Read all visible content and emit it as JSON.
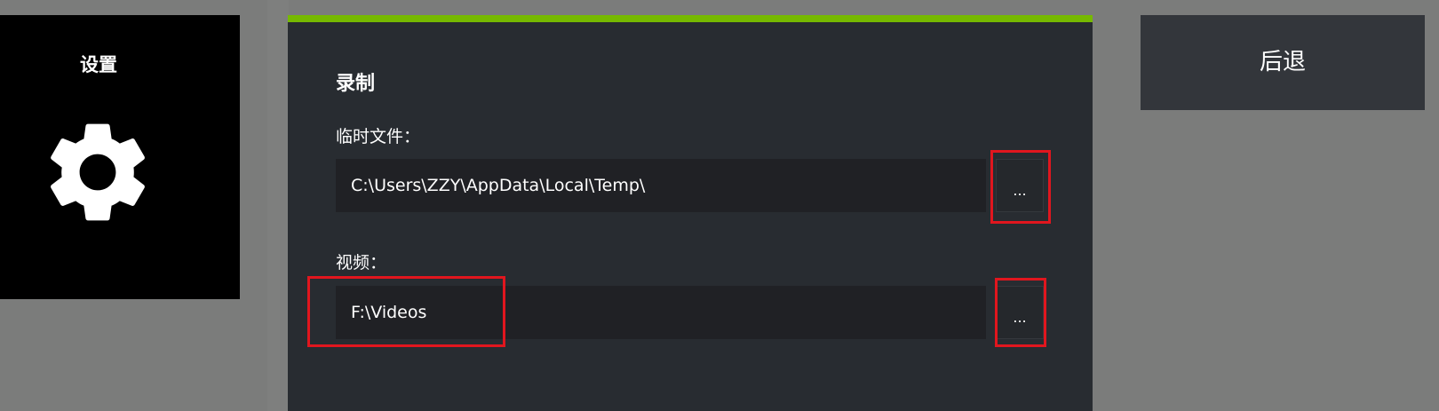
{
  "settings_tile": {
    "title": "设置",
    "icon": "gear-icon"
  },
  "panel": {
    "accent_color": "#76b900",
    "section_title": "录制",
    "temp_files": {
      "label": "临时文件：",
      "value": "C:\\Users\\ZZY\\AppData\\Local\\Temp\\",
      "browse_label": "..."
    },
    "videos": {
      "label": "视频：",
      "value": "F:\\Videos",
      "browse_label": "..."
    }
  },
  "back_button": {
    "label": "后退"
  },
  "highlight_color": "#e1161e"
}
